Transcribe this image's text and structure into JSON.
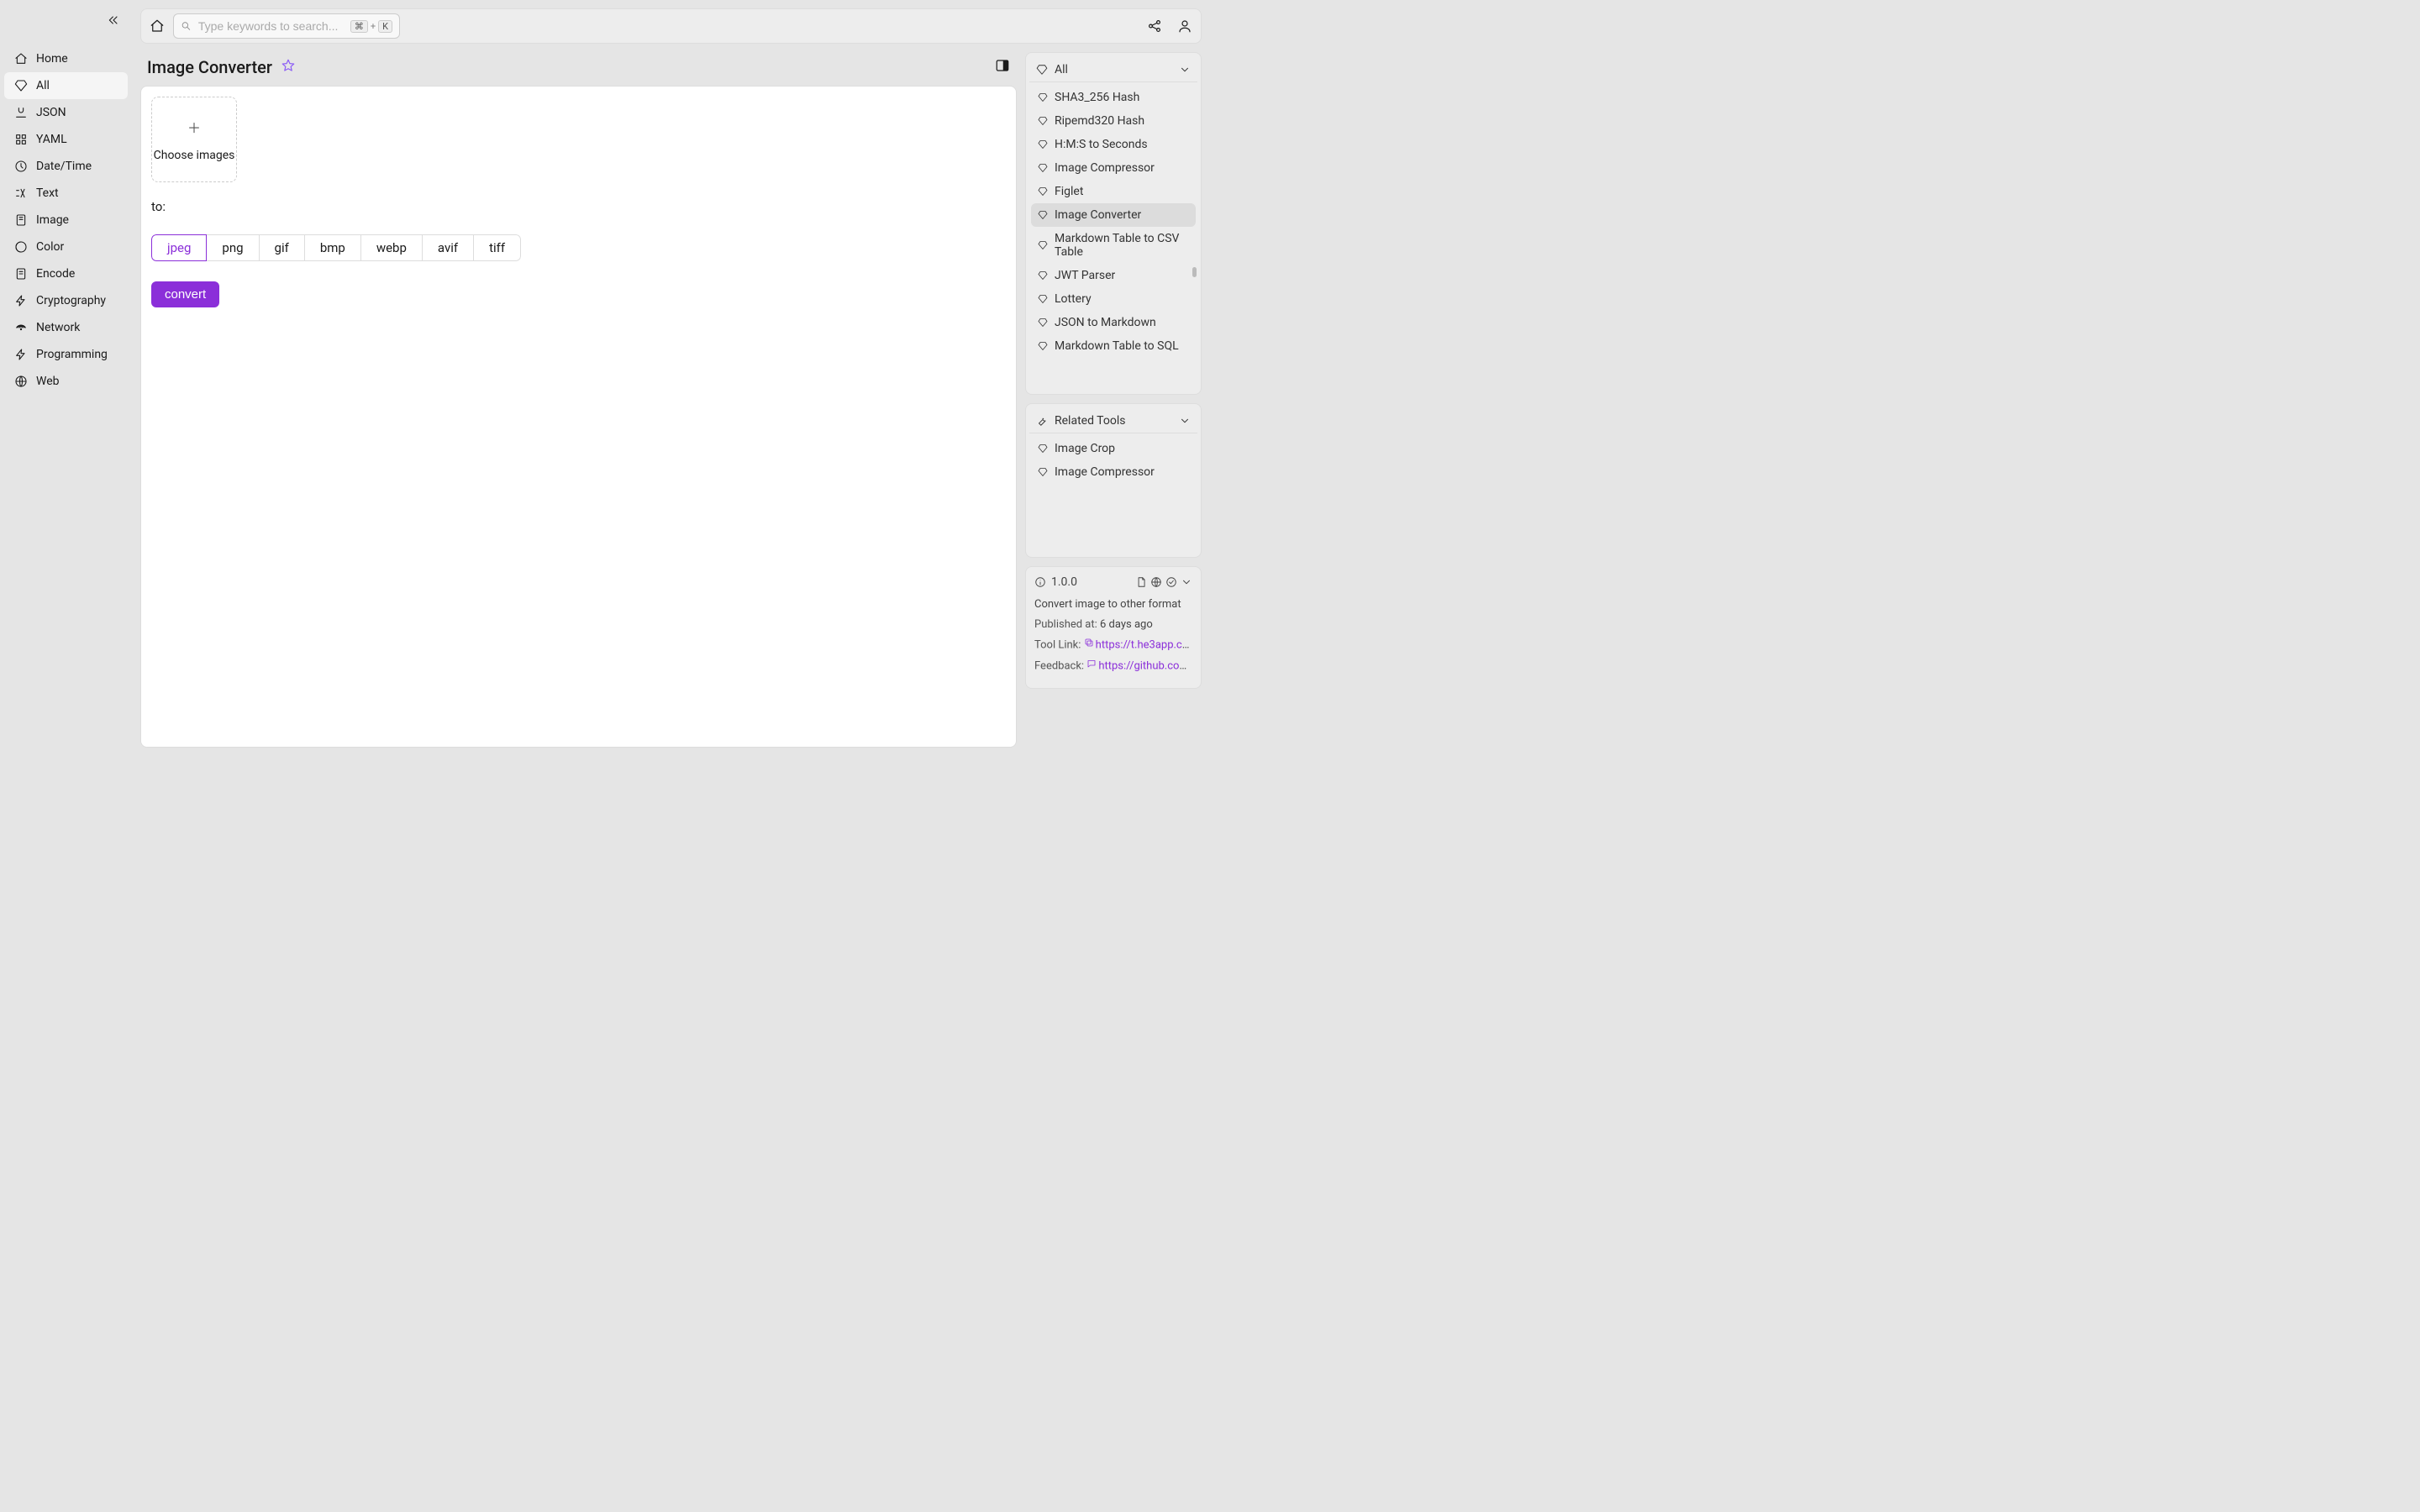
{
  "sidebar": {
    "items": [
      {
        "label": "Home"
      },
      {
        "label": "All"
      },
      {
        "label": "JSON"
      },
      {
        "label": "YAML"
      },
      {
        "label": "Date/Time"
      },
      {
        "label": "Text"
      },
      {
        "label": "Image"
      },
      {
        "label": "Color"
      },
      {
        "label": "Encode"
      },
      {
        "label": "Cryptography"
      },
      {
        "label": "Network"
      },
      {
        "label": "Programming"
      },
      {
        "label": "Web"
      }
    ],
    "active_index": 1
  },
  "search": {
    "placeholder": "Type keywords to search...",
    "shortcut_mod": "⌘",
    "shortcut_plus": "+",
    "shortcut_key": "K"
  },
  "page": {
    "title": "Image Converter",
    "dropzone_label": "Choose images",
    "to_label": "to:",
    "formats": [
      "jpeg",
      "png",
      "gif",
      "bmp",
      "webp",
      "avif",
      "tiff"
    ],
    "selected_format": "jpeg",
    "convert_label": "convert"
  },
  "right": {
    "all_header": "All",
    "all_items": [
      "SHA3_256 Hash",
      "Ripemd320 Hash",
      "H:M:S to Seconds",
      "Image Compressor",
      "Figlet",
      "Image Converter",
      "Markdown Table to CSV Table",
      "JWT Parser",
      "Lottery",
      "JSON to Markdown",
      "Markdown Table to SQL"
    ],
    "all_active_index": 5,
    "related_header": "Related Tools",
    "related_items": [
      "Image Crop",
      "Image Compressor"
    ]
  },
  "info": {
    "version": "1.0.0",
    "description": "Convert image to other format",
    "published_label": "Published at:",
    "published_value": "6 days ago",
    "tool_link_label": "Tool Link:",
    "tool_link_url": "https://t.he3app.co…",
    "feedback_label": "Feedback:",
    "feedback_url": "https://github.com/…"
  }
}
